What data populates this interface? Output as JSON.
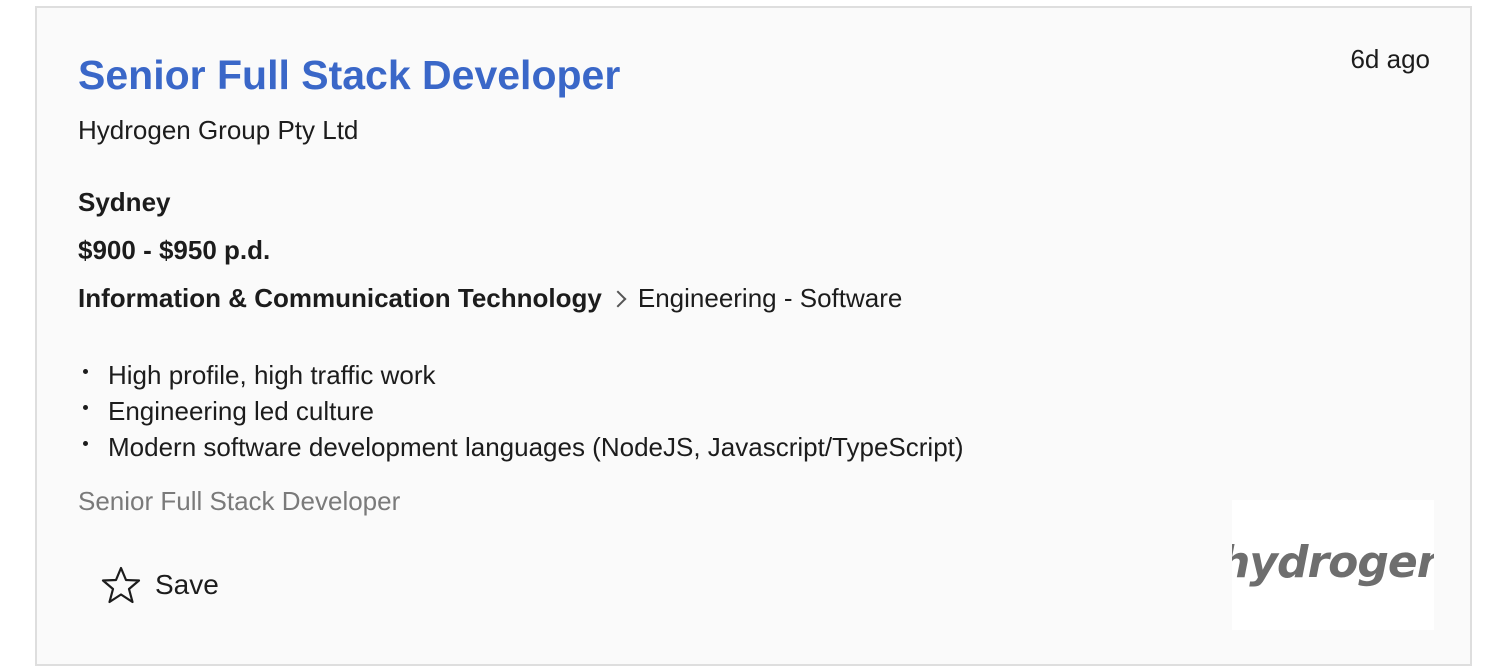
{
  "job": {
    "title": "Senior Full Stack Developer",
    "listed_ago": "6d ago",
    "company": "Hydrogen Group Pty Ltd",
    "location": "Sydney",
    "salary": "$900 - $950 p.d.",
    "classification": "Information & Communication Technology",
    "sub_classification": "Engineering - Software",
    "bullets": [
      "High profile, high traffic work",
      "Engineering led culture",
      "Modern software development languages (NodeJS, Javascript/TypeScript)"
    ],
    "teaser": "Senior Full Stack Developer",
    "save_label": "Save",
    "logo_text": "hydrogen",
    "logo_icon": "company-logo"
  },
  "colors": {
    "title": "#3a67c8",
    "text": "#1c1c1c",
    "muted": "#7a7a7a",
    "card_bg": "#fafafa",
    "logo_text": "#6e6e6e"
  },
  "icons": {
    "save": "star-outline-icon",
    "separator": "chevron-right-icon"
  }
}
